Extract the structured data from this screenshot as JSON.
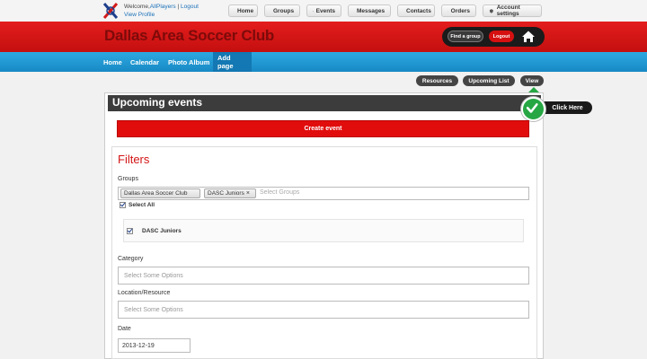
{
  "header": {
    "welcome_text": "Welcome,",
    "username": "AllPlayers",
    "separator": "|",
    "logout_link": "Logout",
    "profile_link": "View Profile"
  },
  "topnav": {
    "home": "Home",
    "groups": "Groups",
    "events": "Events",
    "messages": "Messages",
    "contacts": "Contacts",
    "orders": "Orders",
    "account": "Account settings"
  },
  "club": {
    "name": "Dallas Area Soccer Club",
    "find_group": "Find a group",
    "logout": "Logout"
  },
  "subnav": {
    "items": [
      "Home",
      "Calendar",
      "Photo Album",
      "Add page"
    ]
  },
  "view_buttons": {
    "resources": "Resources",
    "upcoming_list": "Upcoming List",
    "view": "View"
  },
  "tooltip": {
    "click_here": "Click Here"
  },
  "panel": {
    "title": "Upcoming events",
    "create_event": "Create event"
  },
  "filters": {
    "heading": "Filters",
    "groups_label": "Groups",
    "selected_groups": [
      "Dallas Area Soccer Club",
      "DASC Juniors"
    ],
    "groups_placeholder": "Select Groups",
    "select_all": "Select All",
    "sub_group": "DASC Juniors",
    "category_label": "Category",
    "category_placeholder": "Select Some Options",
    "location_label": "Location/Resource",
    "location_placeholder": "Select Some Options",
    "date_label": "Date",
    "date_value": "2013-12-19"
  },
  "colors": {
    "brand_red": "#e41d1d",
    "nav_blue": "#1f96d2",
    "success_green": "#27a744"
  }
}
